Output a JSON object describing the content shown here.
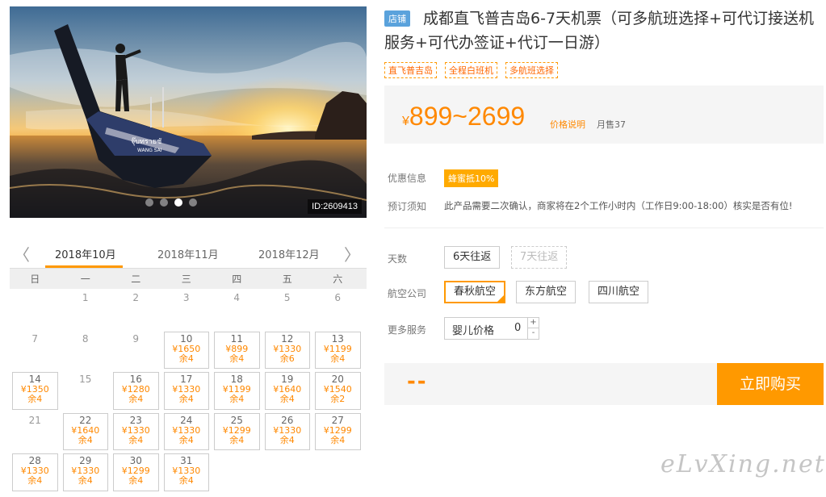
{
  "hero": {
    "id_label": "ID:2609413",
    "boat_text_1": "จุ๊บทรายชั",
    "boat_text_2": "WANG SAI",
    "slide_count": 4,
    "active_slide": 3
  },
  "calendar": {
    "prev_icon": "chevron-left-icon",
    "next_icon": "chevron-right-icon",
    "months": [
      "2018年10月",
      "2018年11月",
      "2018年12月"
    ],
    "active_month": 0,
    "weekdays": [
      "日",
      "一",
      "二",
      "三",
      "四",
      "五",
      "六"
    ],
    "leading_blanks": 1,
    "days": [
      {
        "d": "1"
      },
      {
        "d": "2"
      },
      {
        "d": "3"
      },
      {
        "d": "4"
      },
      {
        "d": "5"
      },
      {
        "d": "6"
      },
      {
        "d": "7"
      },
      {
        "d": "8"
      },
      {
        "d": "9"
      },
      {
        "d": "10",
        "price": "¥1650",
        "stock": "余4"
      },
      {
        "d": "11",
        "price": "¥899",
        "stock": "余4"
      },
      {
        "d": "12",
        "price": "¥1330",
        "stock": "余6"
      },
      {
        "d": "13",
        "price": "¥1199",
        "stock": "余4"
      },
      {
        "d": "14",
        "price": "¥1350",
        "stock": "余4"
      },
      {
        "d": "15"
      },
      {
        "d": "16",
        "price": "¥1280",
        "stock": "余4"
      },
      {
        "d": "17",
        "price": "¥1330",
        "stock": "余4"
      },
      {
        "d": "18",
        "price": "¥1199",
        "stock": "余4"
      },
      {
        "d": "19",
        "price": "¥1640",
        "stock": "余4"
      },
      {
        "d": "20",
        "price": "¥1540",
        "stock": "余2"
      },
      {
        "d": "21"
      },
      {
        "d": "22",
        "price": "¥1640",
        "stock": "余4"
      },
      {
        "d": "23",
        "price": "¥1330",
        "stock": "余4"
      },
      {
        "d": "24",
        "price": "¥1330",
        "stock": "余4"
      },
      {
        "d": "25",
        "price": "¥1299",
        "stock": "余4"
      },
      {
        "d": "26",
        "price": "¥1330",
        "stock": "余4"
      },
      {
        "d": "27",
        "price": "¥1299",
        "stock": "余4"
      },
      {
        "d": "28",
        "price": "¥1330",
        "stock": "余4"
      },
      {
        "d": "29",
        "price": "¥1330",
        "stock": "余4"
      },
      {
        "d": "30",
        "price": "¥1299",
        "stock": "余4"
      },
      {
        "d": "31",
        "price": "¥1330",
        "stock": "余4"
      }
    ]
  },
  "product": {
    "shop_tag": "店铺",
    "title": "成都直飞普吉岛6-7天机票（可多航班选择+可代订接送机服务+可代办签证+代订一日游）",
    "features": [
      "直飞普吉岛",
      "全程白班机",
      "多航班选择"
    ],
    "price": {
      "currency": "¥",
      "range": "899~2699",
      "explain": "价格说明",
      "monthly_sales": "月售37"
    },
    "promo": {
      "label": "优惠信息",
      "badge": "蜂蜜抵10%"
    },
    "notice": {
      "label": "预订须知",
      "text": "此产品需要二次确认，商家将在2个工作小时内（工作日9:00-18:00）核实是否有位!"
    },
    "days": {
      "label": "天数",
      "options": [
        "6天往返",
        "7天往返"
      ]
    },
    "airline": {
      "label": "航空公司",
      "options": [
        "春秋航空",
        "东方航空",
        "四川航空"
      ]
    },
    "service": {
      "label": "更多服务",
      "item": "婴儿价格",
      "qty": "0",
      "plus": "+",
      "minus": "-"
    },
    "total": "--",
    "buy_label": "立即购买"
  },
  "watermark": "eLvXing.net",
  "colors": {
    "accent": "#ff9900",
    "price": "#ff8800",
    "shop_tag": "#5aa2dc"
  }
}
